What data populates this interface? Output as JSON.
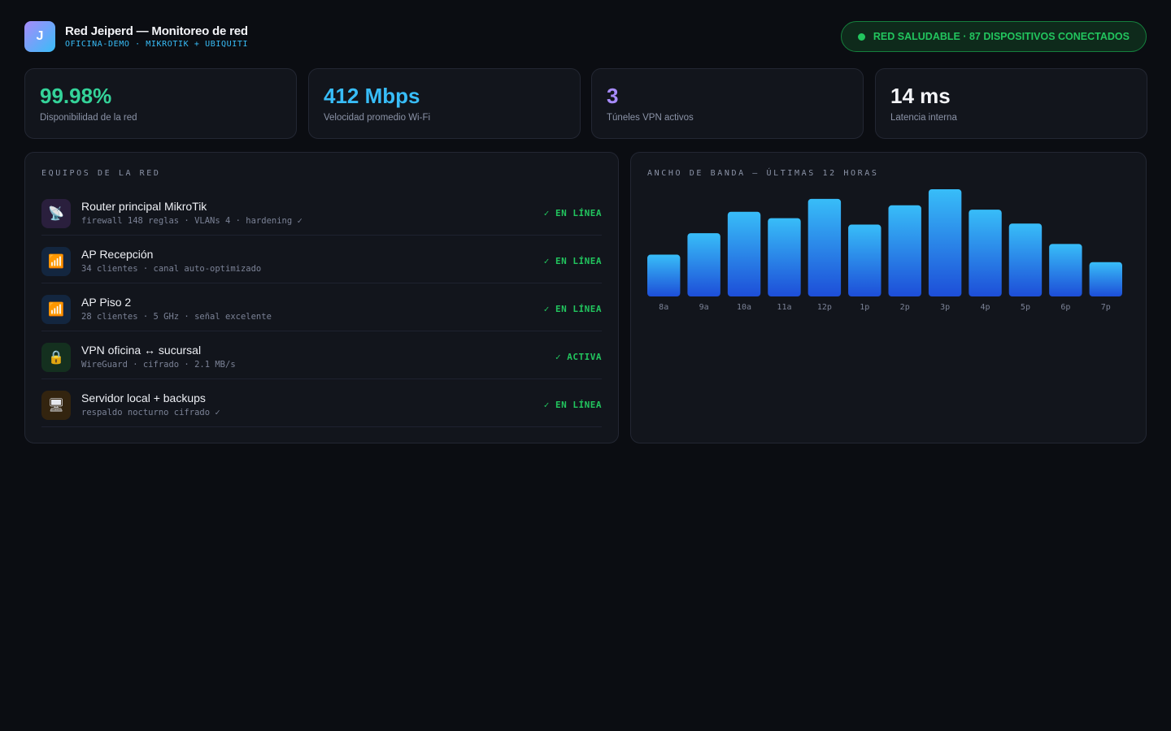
{
  "header": {
    "logo_letter": "J",
    "title": "Red Jeiperd — Monitoreo de red",
    "subtitle": "OFICINA-DEMO · MIKROTIK + UBIQUITI",
    "status": "RED SALUDABLE · 87 DISPOSITIVOS CONECTADOS"
  },
  "colors": {
    "green": "#22c55e",
    "blue": "#38bdf8",
    "purple": "#a78bfa",
    "bar_top": "#38bdf8",
    "bar_bottom": "#1d4ed8"
  },
  "stats": [
    {
      "value": "99.98%",
      "label": "Disponibilidad de la red",
      "color": "#34d399"
    },
    {
      "value": "412 Mbps",
      "label": "Velocidad promedio Wi-Fi",
      "color": "#38bdf8"
    },
    {
      "value": "3",
      "label": "Túneles VPN activos",
      "color": "#a78bfa"
    },
    {
      "value": "14 ms",
      "label": "Latencia interna",
      "color": "#f3f4f8"
    }
  ],
  "devices_panel": {
    "title": "EQUIPOS DE LA RED",
    "items": [
      {
        "icon": "satellite-dish-icon",
        "glyph": "📡",
        "name": "Router principal MikroTik",
        "meta": "firewall 148 reglas · VLANs 4 · hardening ✓",
        "status": "✓ EN LÍNEA"
      },
      {
        "icon": "wifi-signal-icon",
        "glyph": "📶",
        "name": "AP Recepción",
        "meta": "34 clientes · canal auto-optimizado",
        "status": "✓ EN LÍNEA"
      },
      {
        "icon": "wifi-signal-icon",
        "glyph": "📶",
        "name": "AP Piso 2",
        "meta": "28 clientes · 5 GHz · señal excelente",
        "status": "✓ EN LÍNEA"
      },
      {
        "icon": "lock-icon",
        "glyph": "🔒",
        "name": "VPN oficina ↔ sucursal",
        "meta": "WireGuard · cifrado · 2.1 MB/s",
        "status": "✓ ACTIVA"
      },
      {
        "icon": "server-monitor-icon",
        "glyph": "🖥",
        "name": "Servidor local + backups",
        "meta": "respaldo nocturno cifrado ✓",
        "status": "✓ EN LÍNEA"
      }
    ]
  },
  "bandwidth_panel": {
    "title": "ANCHO DE BANDA — ÚLTIMAS 12 HORAS"
  },
  "chart_data": {
    "type": "bar",
    "title": "ANCHO DE BANDA — ÚLTIMAS 12 HORAS",
    "categories": [
      "8a",
      "9a",
      "10a",
      "11a",
      "12p",
      "1p",
      "2p",
      "3p",
      "4p",
      "5p",
      "6p",
      "7p"
    ],
    "values": [
      39,
      59,
      79,
      73,
      91,
      67,
      85,
      100,
      81,
      68,
      49,
      32
    ],
    "xlabel": "",
    "ylabel": "",
    "ylim": [
      0,
      100
    ],
    "grid": false
  }
}
